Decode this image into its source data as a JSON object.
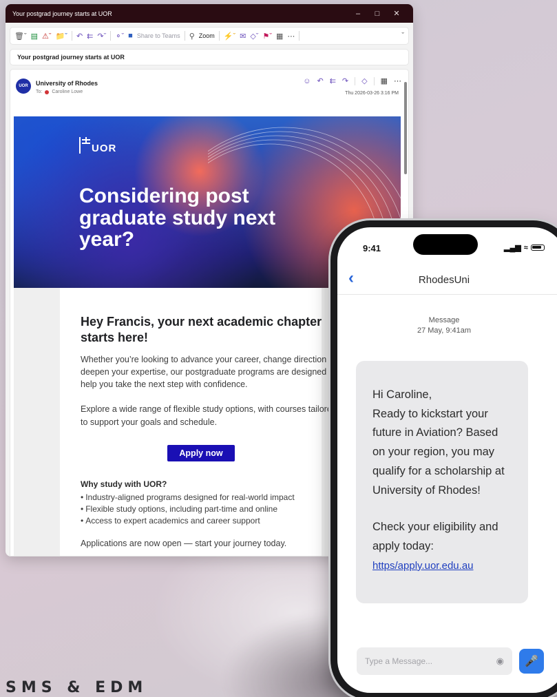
{
  "footer_label": "SMS & EDM",
  "outlook": {
    "window_title": "Your postgrad journey starts at UOR",
    "toolbar": {
      "share_to_teams": "Share to Teams",
      "zoom": "Zoom"
    },
    "subject": "Your postgrad journey starts at UOR",
    "message": {
      "avatar_text": "UOR",
      "sender": "University of Rhodes",
      "to_label": "To:",
      "recipient": "Caroline Lowe",
      "date": "Thu 2026-03-26 3:16 PM"
    },
    "email": {
      "logo_text": "UOR",
      "headline": "Considering post graduate study next year?",
      "greeting": "Hey Francis, your next academic chapter starts here!",
      "paragraph1": "Whether you’re looking to advance your career, change direction or deepen your expertise, our postgraduate programs are designed to help you take the next step with confidence.",
      "paragraph2": "Explore a wide range of flexible study options, with courses tailored to support your goals and schedule.",
      "apply_button": "Apply now",
      "why_title": "Why study with UOR?",
      "why_items": [
        "Industry-aligned programs designed for real-world impact",
        "Flexible study options, including part-time and online",
        "Access to expert academics and career support"
      ],
      "closing": "Applications are now open — start your journey today."
    }
  },
  "phone": {
    "time": "9:41",
    "contact": "RhodesUni",
    "meta_label": "Message",
    "meta_date": "27 May, 9:41am",
    "sms": {
      "line1": "Hi Caroline,",
      "line2": "Ready to kickstart your future in Aviation? Based on your region, you may qualify for a scholarship at University of Rhodes!",
      "line3": "Check your eligibility and apply today:",
      "link": "https/apply.uor.edu.au"
    },
    "input_placeholder": "Type a Message..."
  },
  "colors": {
    "titlebar": "#2a0c12",
    "apply_button": "#1a0fb4",
    "sender_avatar": "#1f2fa6",
    "mic_button": "#2f7bea",
    "ios_link": "#2a66d9"
  }
}
